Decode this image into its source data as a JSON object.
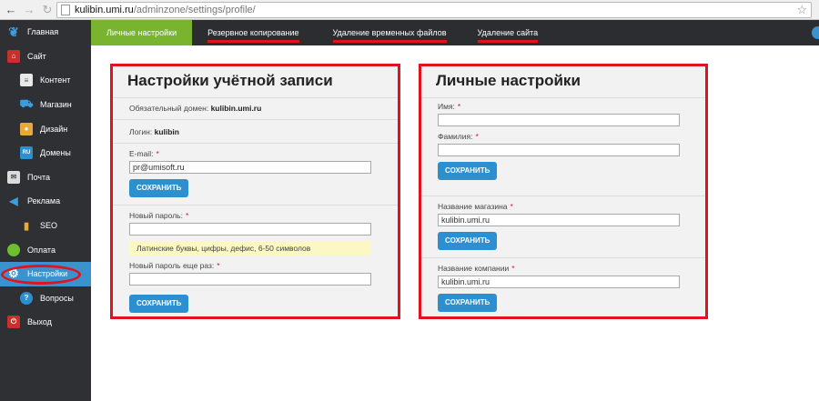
{
  "browser": {
    "host": "kulibin.umi.ru",
    "path": "/adminzone/settings/profile/"
  },
  "sidebar": {
    "items": [
      {
        "label": "Главная",
        "icon": "butterfly-icon",
        "sub": false
      },
      {
        "label": "Сайт",
        "icon": "home-icon",
        "sub": false
      },
      {
        "label": "Контент",
        "icon": "document-icon",
        "sub": true
      },
      {
        "label": "Магазин",
        "icon": "cart-icon",
        "sub": true
      },
      {
        "label": "Дизайн",
        "icon": "palette-icon",
        "sub": true
      },
      {
        "label": "Домены",
        "icon": "domain-icon",
        "sub": true
      },
      {
        "label": "Почта",
        "icon": "mail-icon",
        "sub": false
      },
      {
        "label": "Реклама",
        "icon": "megaphone-icon",
        "sub": false
      },
      {
        "label": "SEO",
        "icon": "bar-chart-icon",
        "sub": true
      },
      {
        "label": "Оплата",
        "icon": "payment-icon",
        "sub": false
      },
      {
        "label": "Настройки",
        "icon": "gear-icon",
        "sub": false
      },
      {
        "label": "Вопросы",
        "icon": "question-icon",
        "sub": true
      },
      {
        "label": "Выход",
        "icon": "power-icon",
        "sub": false
      }
    ],
    "domain_badge": "RU"
  },
  "tabs": [
    "Личные настройки",
    "Резервное копирование",
    "Удаление временных файлов",
    "Удаление сайта"
  ],
  "account": {
    "title": "Настройки учётной записи",
    "domain_label": "Обязательный домен:",
    "domain_value": "kulibin.umi.ru",
    "login_label": "Логин:",
    "login_value": "kulibin",
    "email_label": "E-mail:",
    "email_value": "pr@umisoft.ru",
    "save": "Сохранить",
    "new_password_label": "Новый пароль:",
    "password_hint": "Латинские буквы, цифры, дефис, 6-50 символов",
    "repeat_password_label": "Новый пароль еще раз:",
    "required_mark": "*"
  },
  "personal": {
    "title": "Личные настройки",
    "name_label": "Имя:",
    "name_value": "",
    "surname_label": "Фамилия:",
    "surname_value": "",
    "shop_label": "Название магазина",
    "shop_value": "kulibin.umi.ru",
    "company_label": "Название компании",
    "company_value": "kulibin.umi.ru",
    "save": "Сохранить"
  },
  "colors": {
    "accent": "#79b330",
    "button": "#2b8fd0",
    "highlight": "#e0141e",
    "sidebar": "#2f3034",
    "active": "#3a93cc"
  }
}
